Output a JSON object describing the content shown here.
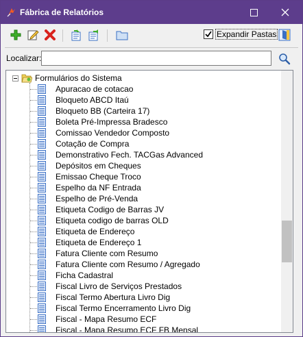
{
  "window": {
    "title": "Fábrica de Relatórios"
  },
  "titlebar_buttons": {
    "maximize_icon": "maximize-icon",
    "close_icon": "close-icon"
  },
  "toolbar": {
    "buttons": [
      {
        "icon": "add-icon"
      },
      {
        "icon": "edit-icon"
      },
      {
        "icon": "delete-icon"
      },
      {
        "icon": "import-icon"
      },
      {
        "icon": "export-icon"
      },
      {
        "icon": "folder-icon"
      }
    ],
    "expand_folders": {
      "label": "Expandir Pastas",
      "checked": true
    },
    "exit_icon": "exit-door-icon"
  },
  "search": {
    "label": "Localizar:",
    "value": "",
    "placeholder": "",
    "icon": "search-icon"
  },
  "tree": {
    "root": {
      "label": "Formulários do Sistema",
      "expanded": true
    },
    "items": [
      "Apuracao de cotacao",
      "Bloqueto ABCD Itaú",
      "Bloqueto BB (Carteira 17)",
      "Boleta Pré-Impressa Bradesco",
      "Comissao Vendedor Composto",
      "Cotação  de Compra",
      "Demonstrativo Fech. TACGas Advanced",
      "Depósitos em Cheques",
      "Emissao Cheque Troco",
      "Espelho da NF Entrada",
      "Espelho de Pré-Venda",
      "Etiqueta Codigo de Barras JV",
      "Etiqueta codigo de  barras OLD",
      "Etiqueta de Endereço",
      "Etiqueta de Endereço 1",
      "Fatura Cliente com Resumo",
      "Fatura Cliente com Resumo / Agregado",
      "Ficha Cadastral",
      "Fiscal  Livro de Serviços Prestados",
      "Fiscal  Termo  Abertura Livro Dig",
      "Fiscal  Termo Encerramento Livro Dig",
      "Fiscal - Mapa Resumo ECF",
      "Fiscal - Mapa Resumo ECF  FB  Mensal"
    ]
  },
  "colors": {
    "titlebar": "#5d3d8c",
    "window_bg": "#f0f0f0",
    "doc_icon": "#3a6fc4",
    "folder": "#e8c64a"
  }
}
